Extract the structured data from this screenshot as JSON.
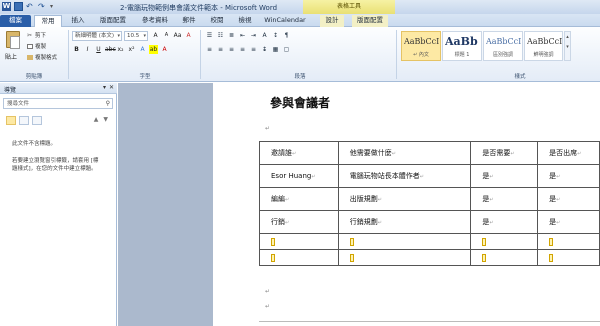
{
  "window": {
    "title": "2-電腦玩物範例串會議文件範本 - Microsoft Word",
    "contextual_group": "表格工具"
  },
  "tabs": [
    {
      "label": "檔案",
      "key": "file"
    },
    {
      "label": "常用",
      "key": "home"
    },
    {
      "label": "插入",
      "key": "insert"
    },
    {
      "label": "版面配置",
      "key": "page-layout"
    },
    {
      "label": "參考資料",
      "key": "references"
    },
    {
      "label": "郵件",
      "key": "mailings"
    },
    {
      "label": "校閱",
      "key": "review"
    },
    {
      "label": "檢視",
      "key": "view"
    },
    {
      "label": "WinCalendar",
      "key": "wincalendar"
    },
    {
      "label": "設計",
      "key": "design"
    },
    {
      "label": "版面配置",
      "key": "table-layout"
    }
  ],
  "ribbon": {
    "clipboard": {
      "paste": "貼上",
      "cut": "剪下",
      "copy": "複製",
      "format_painter": "複製格式",
      "group_label": "剪貼簿"
    },
    "font": {
      "font_name": "新細明體 (本文)",
      "font_size": "10.5",
      "group_label": "字型"
    },
    "paragraph": {
      "group_label": "段落"
    },
    "styles": {
      "items": [
        {
          "sample": "AaBbCcI",
          "name": "↵ 內文"
        },
        {
          "sample": "AaBb",
          "name": "標題 1"
        },
        {
          "sample": "AaBbCcI",
          "name": "區別強調"
        },
        {
          "sample": "AaBbCcI",
          "name": "鮮明強調"
        },
        {
          "sample": "AaBbCcI",
          "name": "鮮明強調"
        }
      ],
      "group_label": "樣式"
    }
  },
  "nav": {
    "title": "導覽",
    "search_placeholder": "搜尋文件",
    "message1": "此文件不含標題。",
    "message2": "若要建立瀏覽窗引標籤，請套用 [標題樣式]，在您的文件中建立標題。"
  },
  "document": {
    "heading": "參與會議者",
    "table": {
      "rows": [
        [
          "邀請誰",
          "他需要做什麼",
          "是否需要",
          "是否出席"
        ],
        [
          "Esor Huang",
          "電腦玩物站長本體作者",
          "是",
          "是"
        ],
        [
          "編編",
          "出版規劃",
          "是",
          "是"
        ],
        [
          "行銷",
          "行銷規劃",
          "是",
          "是"
        ]
      ]
    }
  },
  "colors": {
    "file_tab": "#2a5ea8",
    "page_bg": "#abb9cd",
    "contextual": "#e9e074"
  }
}
